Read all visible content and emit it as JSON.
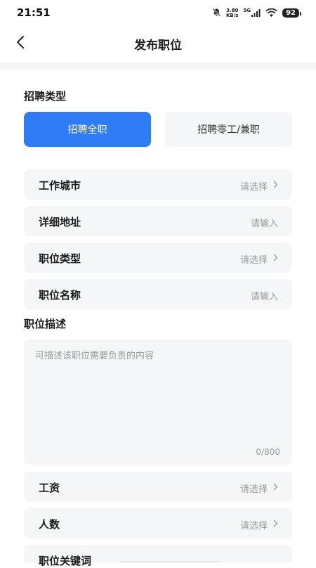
{
  "status_bar": {
    "time": "21:51",
    "net_speed_value": "3.80",
    "net_speed_unit": "KB/s",
    "network_type": "5G",
    "battery": "92"
  },
  "header": {
    "title": "发布职位"
  },
  "recruit_type": {
    "label": "招聘类型",
    "options": [
      "招聘全职",
      "招聘零工/兼职"
    ],
    "selected": "招聘全职"
  },
  "fields": {
    "city": {
      "label": "工作城市",
      "value": "请选择"
    },
    "address": {
      "label": "详细地址",
      "value": "请输入"
    },
    "job_type": {
      "label": "职位类型",
      "value": "请选择"
    },
    "job_name": {
      "label": "职位名称",
      "value": "请输入"
    },
    "salary": {
      "label": "工资",
      "value": "请选择"
    },
    "headcount": {
      "label": "人数",
      "value": "请选择"
    },
    "keywords": {
      "label": "职位关键词"
    }
  },
  "description": {
    "label": "职位描述",
    "placeholder": "可描述该职位需要负责的内容",
    "counter": "0/800"
  },
  "colors": {
    "accent": "#2f7bf5",
    "field_bg": "#f5f6f8",
    "placeholder": "#999999"
  }
}
